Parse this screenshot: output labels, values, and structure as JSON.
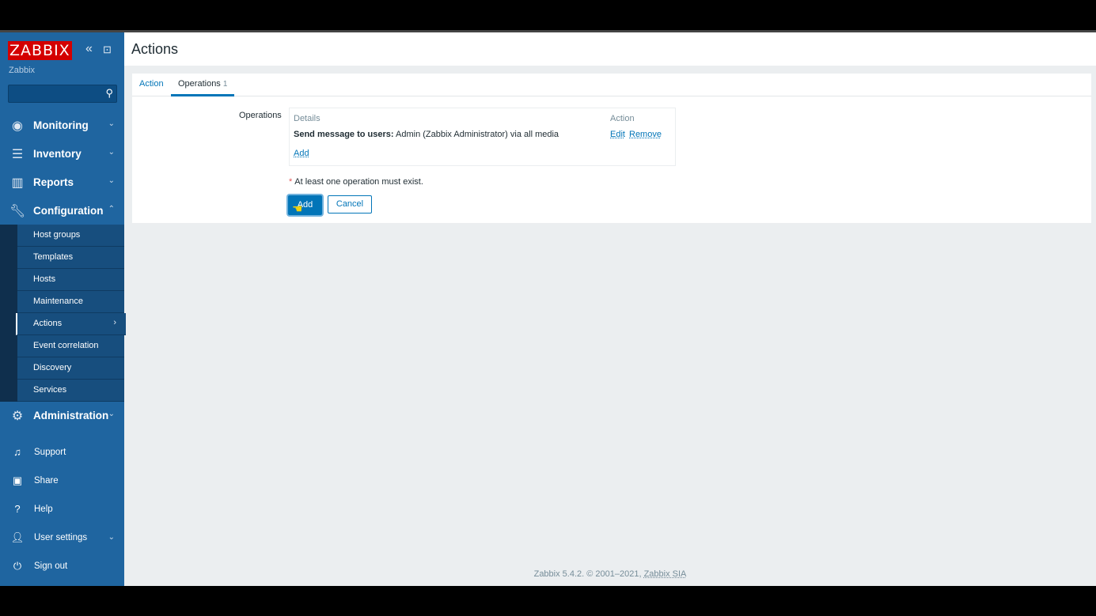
{
  "sidebar": {
    "logo": "ZABBIX",
    "collapse_icon": "«",
    "kiosk_icon": "⊡",
    "server_name": "Zabbix",
    "search_placeholder": "",
    "menu": [
      {
        "label": "Monitoring",
        "icon": "eye-icon"
      },
      {
        "label": "Inventory",
        "icon": "list-icon"
      },
      {
        "label": "Reports",
        "icon": "bar-chart-icon"
      },
      {
        "label": "Configuration",
        "icon": "wrench-icon"
      }
    ],
    "config_submenu": [
      "Host groups",
      "Templates",
      "Hosts",
      "Maintenance",
      "Actions",
      "Event correlation",
      "Discovery",
      "Services"
    ],
    "active_submenu": "Actions",
    "administration": "Administration",
    "bottom": [
      {
        "label": "Support",
        "icon": "headset-icon"
      },
      {
        "label": "Share",
        "icon": "share-icon"
      },
      {
        "label": "Help",
        "icon": "help-icon"
      },
      {
        "label": "User settings",
        "icon": "user-icon"
      },
      {
        "label": "Sign out",
        "icon": "power-icon"
      }
    ]
  },
  "page": {
    "title": "Actions",
    "tabs": [
      {
        "label": "Action"
      },
      {
        "label": "Operations",
        "count": "1"
      }
    ],
    "operations_label": "Operations",
    "table": {
      "col_details": "Details",
      "col_action": "Action",
      "row_bold": "Send message to users:",
      "row_text": " Admin (Zabbix Administrator) via all media",
      "edit": "Edit",
      "remove": "Remove",
      "add_link": "Add"
    },
    "required_note": "At least one operation must exist.",
    "add_button": "Add",
    "cancel_button": "Cancel"
  },
  "footer": {
    "text": "Zabbix 5.4.2. © 2001–2021, ",
    "link": "Zabbix SIA"
  },
  "colors": {
    "sidebar": "#1f65a0",
    "accent": "#0275b8",
    "logo": "#d40000"
  }
}
